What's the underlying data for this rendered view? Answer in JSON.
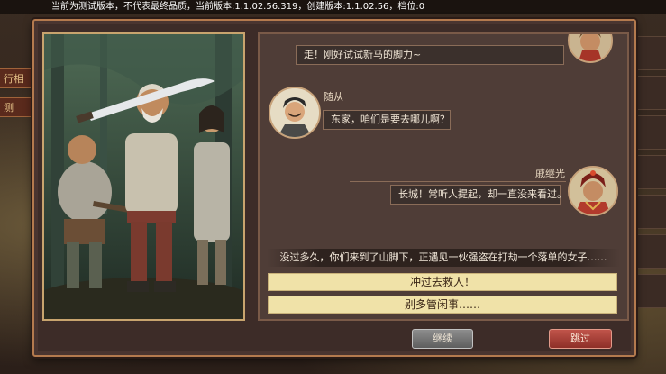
{
  "version_bar": {
    "text": "当前为测试版本，不代表最终品质，当前版本:1.1.02.56.319，创建版本:1.1.02.56，档位:0"
  },
  "background": {
    "left_tab_label": "行相",
    "left_tab_label_2": "测"
  },
  "dialogue": {
    "messages": [
      {
        "speaker": "",
        "text": "走！刚好试试新马的脚力~",
        "side": "right"
      },
      {
        "speaker": "随从",
        "text": "东家，咱们是要去哪儿啊？",
        "side": "left"
      },
      {
        "speaker": "戚继光",
        "text": "长城！常听人提起，却一直没来看过。",
        "side": "right"
      }
    ],
    "narration": "没过多久，你们来到了山脚下，正遇见一伙强盗在打劫一个落单的女子……",
    "choices": [
      {
        "label": "冲过去救人！"
      },
      {
        "label": "别多管闲事……"
      }
    ]
  },
  "buttons": {
    "continue_label": "继续",
    "skip_label": "跳过"
  },
  "colors": {
    "dialog_border": "#b47a4e",
    "choice_bg": "#f0e2a8",
    "skip_button": "#b2463d",
    "continue_button": "#767676"
  }
}
